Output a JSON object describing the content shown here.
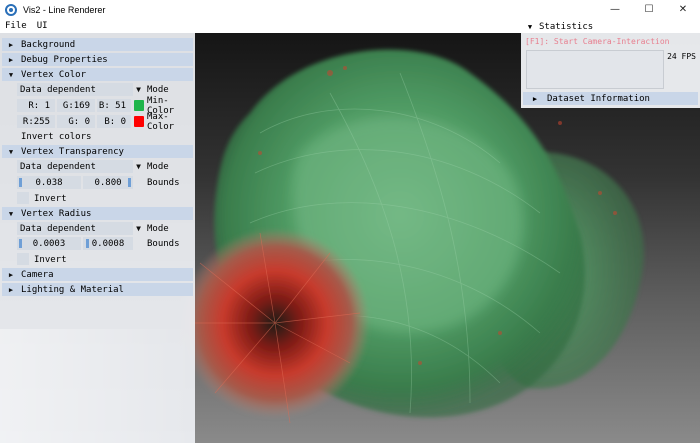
{
  "window": {
    "title": "Vis2 - Line Renderer",
    "controls": {
      "minimize": "—",
      "maximize": "☐",
      "close": "✕"
    }
  },
  "menu": {
    "items": [
      "File",
      "UI"
    ]
  },
  "panel": {
    "sections": {
      "background": "Background",
      "debug": "Debug Properties",
      "vertex_color": "Vertex Color",
      "vertex_transparency": "Vertex Transparency",
      "vertex_radius": "Vertex Radius",
      "camera": "Camera",
      "lighting": "Lighting & Material"
    },
    "vertex_color": {
      "mode_value": "Data dependent",
      "mode_label": "Mode",
      "min": {
        "r": "R:  1",
        "g": "G:169",
        "b": "B: 51",
        "label": "Min-Color",
        "color": "#1fb54a"
      },
      "max": {
        "r": "R:255",
        "g": "G:  0",
        "b": "B:  0",
        "label": "Max-Color",
        "color": "#ff0000"
      },
      "invert_label": "Invert colors"
    },
    "vertex_transparency": {
      "mode_value": "Data dependent",
      "mode_label": "Mode",
      "min_value": "0.038",
      "max_value": "0.800",
      "bounds_label": "Bounds",
      "invert_label": "Invert"
    },
    "vertex_radius": {
      "mode_value": "Data dependent",
      "mode_label": "Mode",
      "min_value": "0.0003",
      "max_value": "0.0008",
      "bounds_label": "Bounds",
      "invert_label": "Invert"
    }
  },
  "stats": {
    "title": "Statistics",
    "hint": "[F1]: Start Camera-Interaction",
    "fps": "24 FPS",
    "dataset_label": "Dataset Information"
  },
  "icons": {
    "collapsed": "▶",
    "expanded": "▼",
    "combo_arrow": "▼"
  }
}
